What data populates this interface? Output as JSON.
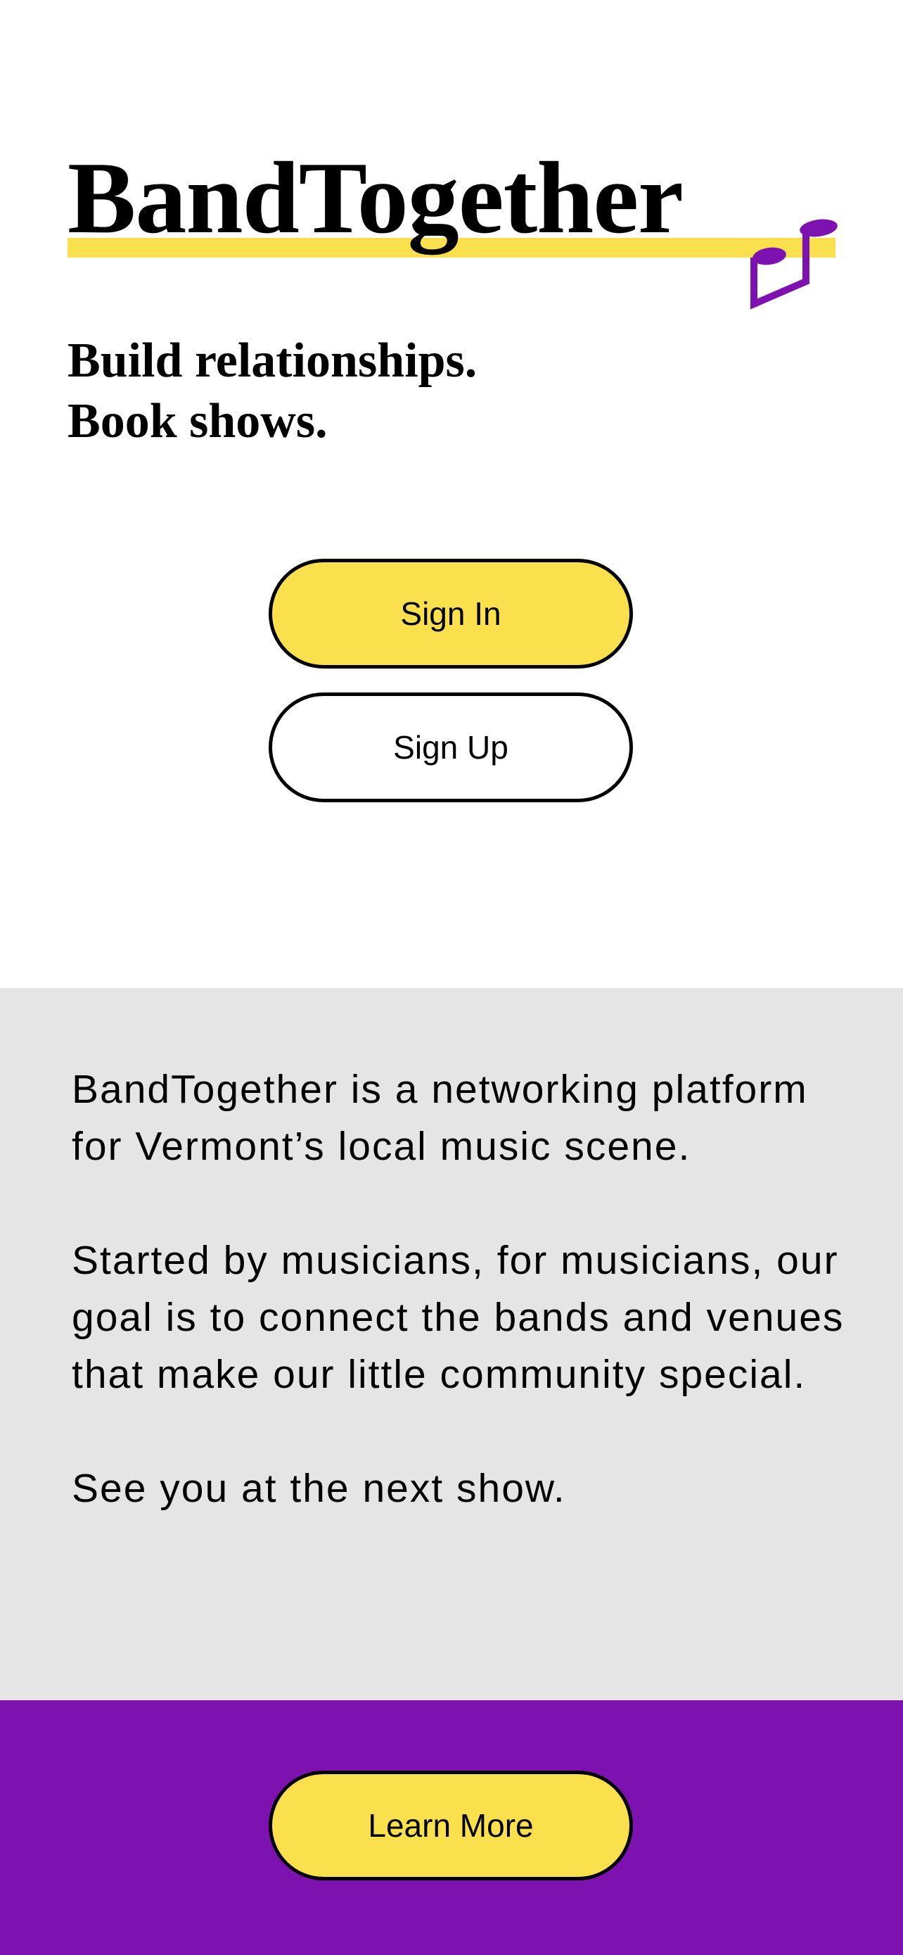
{
  "brand": {
    "title": "BandTogether",
    "icon": "music-note-icon",
    "underline_color": "#fbe04d",
    "icon_color": "#7d12b1"
  },
  "hero": {
    "tagline_line1": "Build relationships.",
    "tagline_line2": "Book shows."
  },
  "auth": {
    "sign_in_label": "Sign In",
    "sign_up_label": "Sign Up"
  },
  "about": {
    "paragraph1": "BandTogether is a networking platform for Vermont’s local music scene.",
    "paragraph2": "Started by musicians, for musicians, our goal is to connect the bands and venues that make our little community special.",
    "paragraph3": "See you at the next show."
  },
  "footer": {
    "learn_more_label": "Learn More"
  },
  "colors": {
    "accent_yellow": "#fbe04d",
    "brand_purple": "#7d12b1",
    "about_background": "#e5e5e5"
  }
}
